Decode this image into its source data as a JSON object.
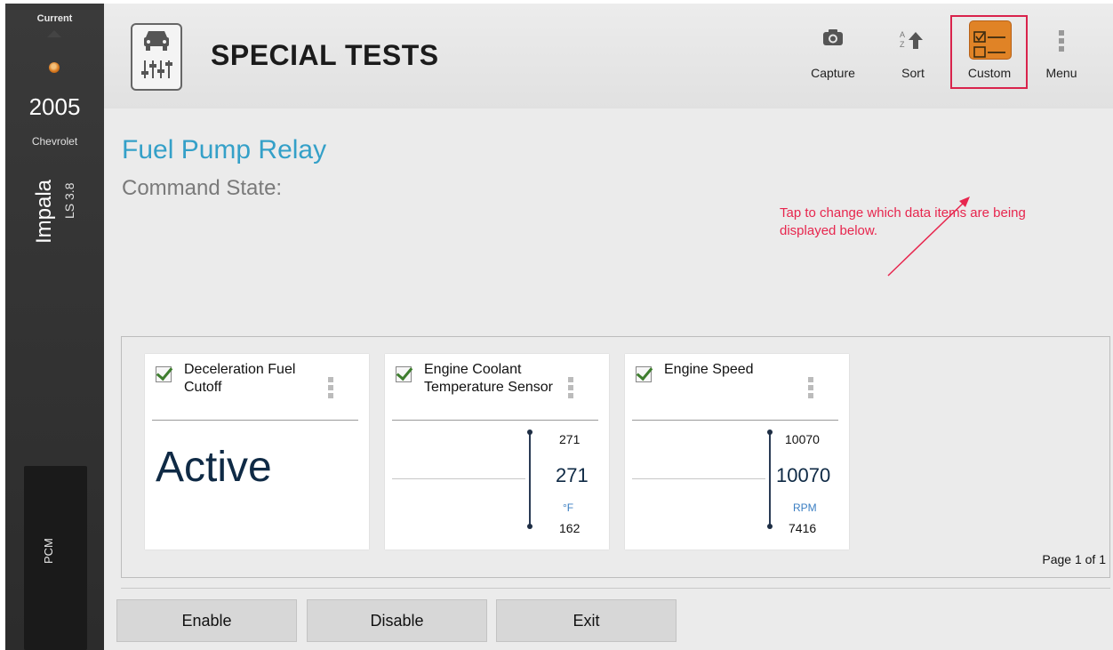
{
  "sidebar": {
    "current_label": "Current",
    "year": "2005",
    "make": "Chevrolet",
    "model": "Impala",
    "trim": "LS 3.8",
    "module": "PCM"
  },
  "header": {
    "title": "SPECIAL TESTS",
    "tools": [
      {
        "label": "Capture",
        "icon": "camera-icon"
      },
      {
        "label": "Sort",
        "icon": "sort-az-icon"
      },
      {
        "label": "Custom",
        "icon": "custom-checklist-icon"
      },
      {
        "label": "Menu",
        "icon": "kebab-menu-icon"
      }
    ]
  },
  "test": {
    "name": "Fuel Pump Relay",
    "command_state_label": "Command State:"
  },
  "annotation": {
    "text": "Tap to change which data items are being displayed below.",
    "color": "#e7264e"
  },
  "cards": [
    {
      "title": "Deceleration Fuel Cutoff",
      "value": "Active"
    },
    {
      "title": "Engine Coolant Temperature Sensor",
      "max": "271",
      "current": "271",
      "unit": "°F",
      "min": "162"
    },
    {
      "title": "Engine Speed",
      "max": "10070",
      "current": "10070",
      "unit": "RPM",
      "min": "7416"
    }
  ],
  "pagination": "Page 1 of 1",
  "buttons": {
    "enable": "Enable",
    "disable": "Disable",
    "exit": "Exit"
  },
  "colors": {
    "accent_title": "#34a0c8",
    "custom_icon": "#e08326",
    "highlight_box": "#d9234c"
  }
}
